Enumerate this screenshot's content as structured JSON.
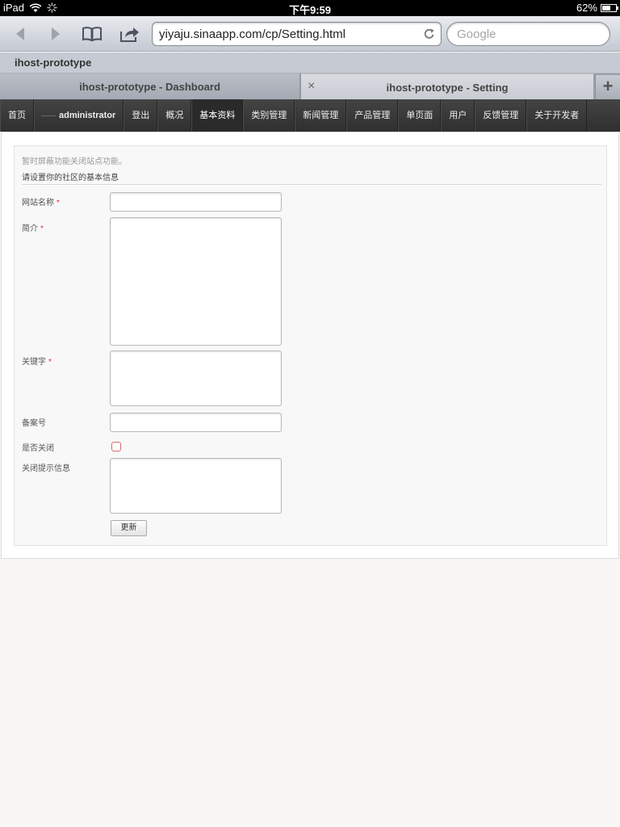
{
  "status_bar": {
    "carrier": "iPad",
    "time": "下午9:59",
    "battery_text": "62%",
    "battery_level": 0.62
  },
  "browser": {
    "url": "yiyaju.sinaapp.com/cp/Setting.html",
    "search_placeholder": "Google",
    "page_title": "ihost-prototype",
    "tabs": [
      {
        "label": "ihost-prototype - Dashboard",
        "active": false
      },
      {
        "label": "ihost-prototype - Setting",
        "active": true
      }
    ],
    "close_glyph": "×",
    "add_tab_glyph": "+"
  },
  "site_nav": {
    "items": [
      {
        "label": "首页"
      },
      {
        "label": "administrator"
      },
      {
        "label": "登出"
      },
      {
        "label": "概况"
      },
      {
        "label": "基本资料",
        "active": true
      },
      {
        "label": "类别管理"
      },
      {
        "label": "新闻管理"
      },
      {
        "label": "产品管理"
      },
      {
        "label": "单页面"
      },
      {
        "label": "用户"
      },
      {
        "label": "反馈管理"
      },
      {
        "label": "关于开发者"
      }
    ]
  },
  "form": {
    "notice": "暂时屏蔽功能关闭站点功能。",
    "heading": "请设置你的社区的基本信息",
    "required_mark": "*",
    "fields": {
      "site_name": {
        "label": "网站名称",
        "value": ""
      },
      "intro": {
        "label": "简介",
        "value": ""
      },
      "keywords": {
        "label": "关键字",
        "value": ""
      },
      "icp": {
        "label": "备案号",
        "value": ""
      },
      "closed": {
        "label": "是否关闭",
        "checked": false
      },
      "close_message": {
        "label": "关闭提示信息",
        "value": ""
      }
    },
    "submit_label": "更新"
  },
  "colors": {
    "nav_bg": "#333333",
    "required": "#dd3333",
    "page_bg": "#f8f7f5"
  }
}
